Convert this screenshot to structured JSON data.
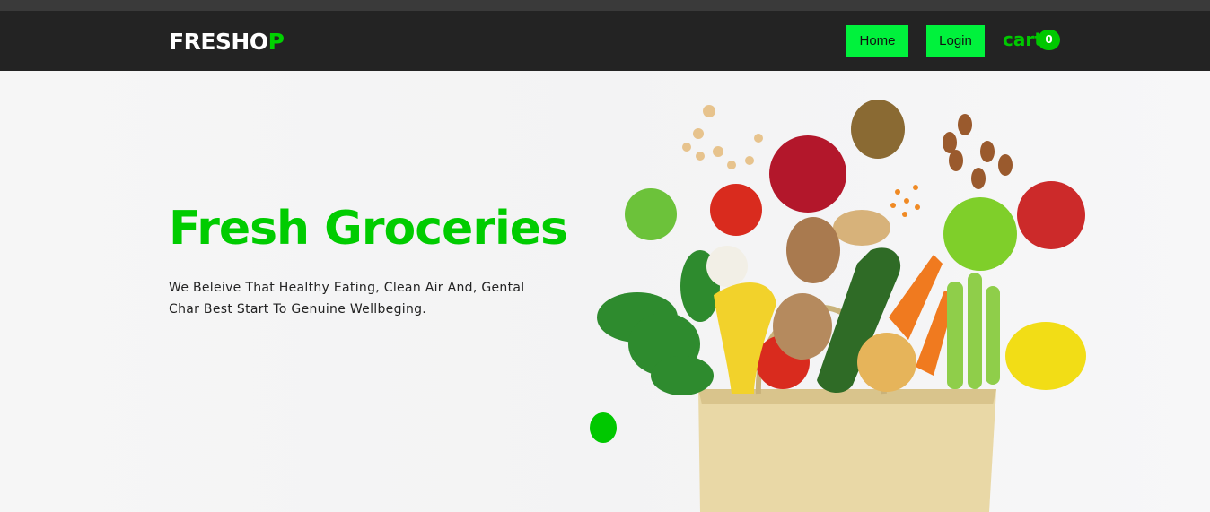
{
  "header": {
    "brand_main": "FRESHO",
    "brand_accent": "P",
    "nav": {
      "home_label": "Home",
      "login_label": "Login"
    },
    "cart": {
      "label": "cart",
      "count": "0"
    }
  },
  "hero": {
    "title": "Fresh Groceries",
    "text": "We Beleive That Healthy Eating, Clean Air And, Gental Char Best Start To Genuine Wellbeging."
  },
  "colors": {
    "accent": "#00cc00",
    "button": "#00f23c",
    "navbar": "#232323"
  }
}
